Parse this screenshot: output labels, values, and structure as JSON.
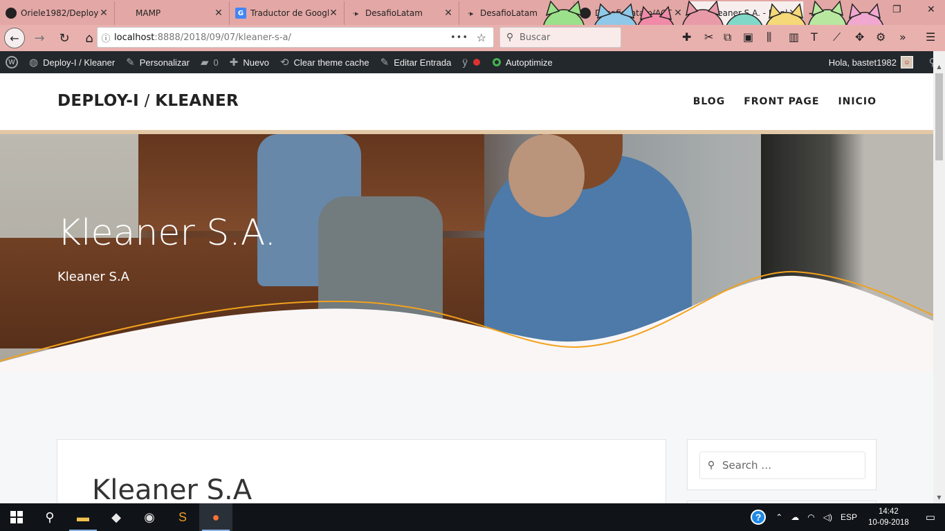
{
  "browser": {
    "tabs": [
      {
        "title": "Oriele1982/Deploy-",
        "favicon": "github-icon",
        "active": false
      },
      {
        "title": "MAMP",
        "favicon": "blank-icon",
        "active": false
      },
      {
        "title": "Traductor de Googl",
        "favicon": "google-translate-icon",
        "active": false
      },
      {
        "title": "DesafioLatam",
        "favicon": "desafiolatam-icon",
        "active": false
      },
      {
        "title": "DesafioLatam",
        "favicon": "desafiolatam-icon",
        "active": false
      },
      {
        "title": "DesafioLatam/ACT",
        "favicon": "github-icon",
        "active": false
      },
      {
        "title": "Kleaner S.A. - Deploy-I",
        "favicon": "blank-icon",
        "active": true
      }
    ],
    "url": {
      "host": "localhost",
      "path": ":8888/2018/09/07/kleaner-s-a/"
    },
    "search_placeholder": "Buscar",
    "theme_colors": {
      "tabstrip": "#e3a7a5",
      "toolbar": "#e9b1ae"
    }
  },
  "admin_bar": {
    "site_name": "Deploy-I / Kleaner",
    "customize": "Personalizar",
    "comments_count": "0",
    "new": "Nuevo",
    "clear_cache": "Clear theme cache",
    "edit_post": "Editar Entrada",
    "autoptimize": "Autoptimize",
    "greeting": "Hola, bastet1982"
  },
  "site": {
    "title_part1": "DEPLOY-I",
    "title_sep": " / ",
    "title_part2": "KLEANER",
    "nav": [
      "BLOG",
      "FRONT PAGE",
      "INICIO"
    ]
  },
  "hero": {
    "title": "Kleaner S.A.",
    "subtitle": "Kleaner S.A"
  },
  "article": {
    "title": "Kleaner S.A"
  },
  "sidebar": {
    "search_placeholder": "Search …"
  },
  "taskbar": {
    "apps": [
      "file-explorer-icon",
      "git-icon",
      "github-desktop-icon",
      "sublime-text-icon",
      "firefox-icon"
    ],
    "language": "ESP",
    "time": "14:42",
    "date": "10-09-2018"
  }
}
